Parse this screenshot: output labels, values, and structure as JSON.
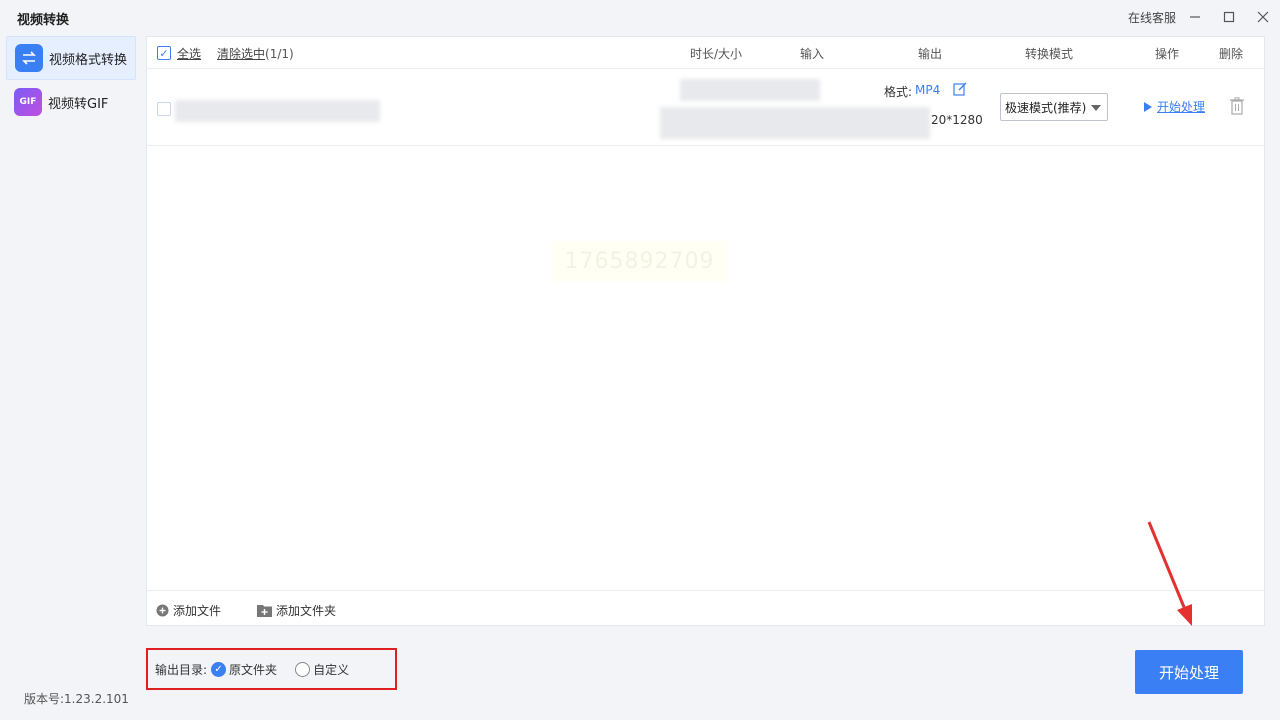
{
  "window": {
    "title": "视频转换",
    "support_label": "在线客服"
  },
  "sidebar": {
    "items": [
      {
        "label": "视频格式转换",
        "icon": "swap-arrows-icon",
        "active": true
      },
      {
        "label": "视频转GIF",
        "icon": "gif-icon",
        "active": false
      }
    ],
    "version": "版本号:1.23.2.101"
  },
  "table": {
    "select_all": "全选",
    "clear_selected": "清除选中",
    "selected_count": "(1/1)",
    "columns": {
      "duration_size": "时长/大小",
      "input": "输入",
      "output": "输出",
      "mode": "转换模式",
      "action": "操作",
      "delete": "删除"
    },
    "rows": [
      {
        "format_label": "格式:",
        "format_value": "MP4",
        "resolution_partial": "20*1280",
        "mode_value": "极速模式(推荐)",
        "start_label": "开始处理"
      }
    ]
  },
  "watermark": "1765892709",
  "footer": {
    "add_file": "添加文件",
    "add_folder": "添加文件夹"
  },
  "output_dir": {
    "label": "输出目录:",
    "options": [
      "原文件夹",
      "自定义"
    ],
    "selected": "原文件夹"
  },
  "start_button": "开始处理",
  "colors": {
    "accent": "#3b7ff5",
    "highlight_box": "#e02020"
  }
}
